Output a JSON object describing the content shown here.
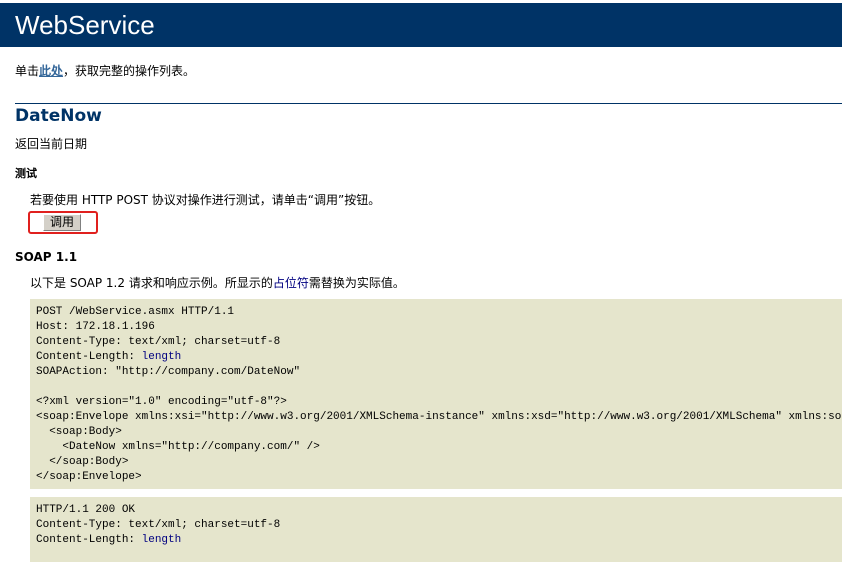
{
  "banner": {
    "title": "WebService"
  },
  "intro": {
    "prefix": "单击",
    "link": "此处",
    "suffix": "，获取完整的操作列表。"
  },
  "operation": {
    "name": "DateNow",
    "description": "返回当前日期"
  },
  "test": {
    "heading": "测试",
    "instructions": "若要使用 HTTP POST 协议对操作进行测试，请单击“调用”按钮。",
    "invoke_label": "调用"
  },
  "soap": {
    "heading": "SOAP 1.1",
    "text_prefix": "以下是 SOAP 1.2 请求和响应示例。所显示的",
    "placeholder_word": "占位符",
    "text_suffix": "需替换为实际值。"
  },
  "request": {
    "line1": "POST /WebService.asmx HTTP/1.1",
    "line2": "Host: 172.18.1.196",
    "line3": "Content-Type: text/xml; charset=utf-8",
    "line4_label": "Content-Length: ",
    "line4_value": "length",
    "line5": "SOAPAction: \"http://company.com/DateNow\"",
    "line6": "",
    "line7": "<?xml version=\"1.0\" encoding=\"utf-8\"?>",
    "line8": "<soap:Envelope xmlns:xsi=\"http://www.w3.org/2001/XMLSchema-instance\" xmlns:xsd=\"http://www.w3.org/2001/XMLSchema\" xmlns:soap=\"http://schemas.xmlsoap.org/soap/envelope/\">",
    "line9": "  <soap:Body>",
    "line10": "    <DateNow xmlns=\"http://company.com/\" />",
    "line11": "  </soap:Body>",
    "line12": "</soap:Envelope>"
  },
  "response": {
    "line1": "HTTP/1.1 200 OK",
    "line2": "Content-Type: text/xml; charset=utf-8",
    "line3_label": "Content-Length: ",
    "line3_value": "length"
  },
  "colors": {
    "banner_bg": "#003366",
    "code_bg": "#e5e5cc",
    "highlight": "#e0201e",
    "link": "#336699"
  }
}
